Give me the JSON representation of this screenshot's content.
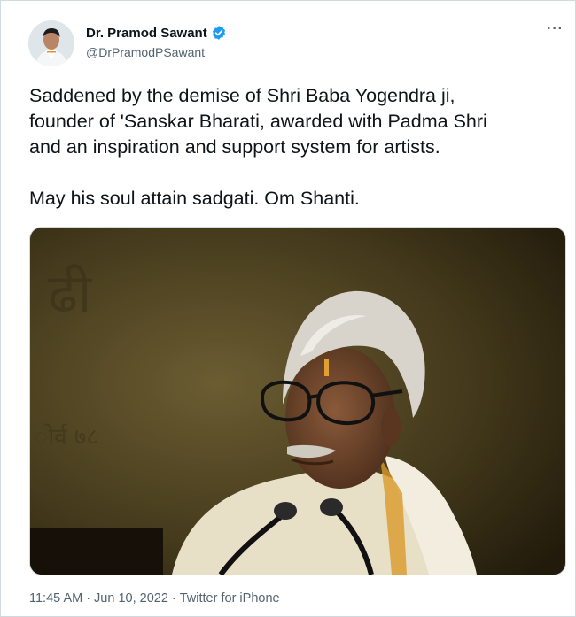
{
  "author": {
    "display_name": "Dr. Pramod Sawant",
    "handle": "@DrPramodPSawant",
    "verified": true,
    "verified_icon": "verified-badge-icon",
    "accent_color": "#1d9bf0"
  },
  "more_icon": "···",
  "tweet": {
    "line1": "Saddened by the demise of Shri Baba Yogendra ji,",
    "line2": "founder of 'Sanskar Bharati, awarded with Padma Shri",
    "line3": "and an inspiration and support system for artists.",
    "line4": "May his soul attain sadgati. Om Shanti."
  },
  "meta": {
    "time": "11:45 AM",
    "sep1": "·",
    "date": "Jun 10, 2022",
    "sep2": "·",
    "source": "Twitter for iPhone"
  }
}
